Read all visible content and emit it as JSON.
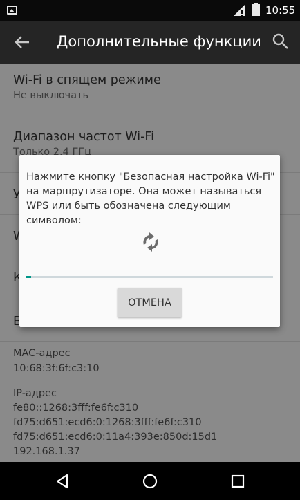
{
  "status_bar": {
    "time": "10:55",
    "icons": [
      "image-notification-icon",
      "signal-icon",
      "battery-icon"
    ]
  },
  "toolbar": {
    "title": "Дополнительные функции",
    "back_icon": "arrow-back-icon",
    "search_icon": "search-icon"
  },
  "settings": [
    {
      "title": "Wi-Fi в спящем режиме",
      "subtitle": "Не выключать"
    },
    {
      "title": "Диапазон частот Wi-Fi",
      "subtitle": "Только 2.4 ГГц"
    },
    {
      "title": "У"
    },
    {
      "title": "W"
    },
    {
      "title": "К"
    },
    {
      "title": "В"
    }
  ],
  "mac": {
    "label": "MAC-адрес",
    "value": "10:68:3f:6f:c3:10"
  },
  "ip": {
    "label": "IP-адрес",
    "values": [
      "fe80::1268:3fff:fe6f:c310",
      "fd75:d651:ecd6:0:1268:3fff:fe6f:c310",
      "fd75:d651:ecd6:0:11a4:393e:850d:15d1",
      "192.168.1.37"
    ]
  },
  "dialog": {
    "message": "Нажмите кнопку \"Безопасная настройка Wi-Fi\" на маршрутизаторе. Она может называться WPS или быть обозначена следующим символом:",
    "icon": "wps-sync-icon",
    "progress": 0.02,
    "cancel_label": "ОТМЕНА",
    "accent_color": "#009688"
  },
  "nav_bar": {
    "icons": [
      "nav-back-icon",
      "nav-home-icon",
      "nav-recents-icon"
    ]
  }
}
